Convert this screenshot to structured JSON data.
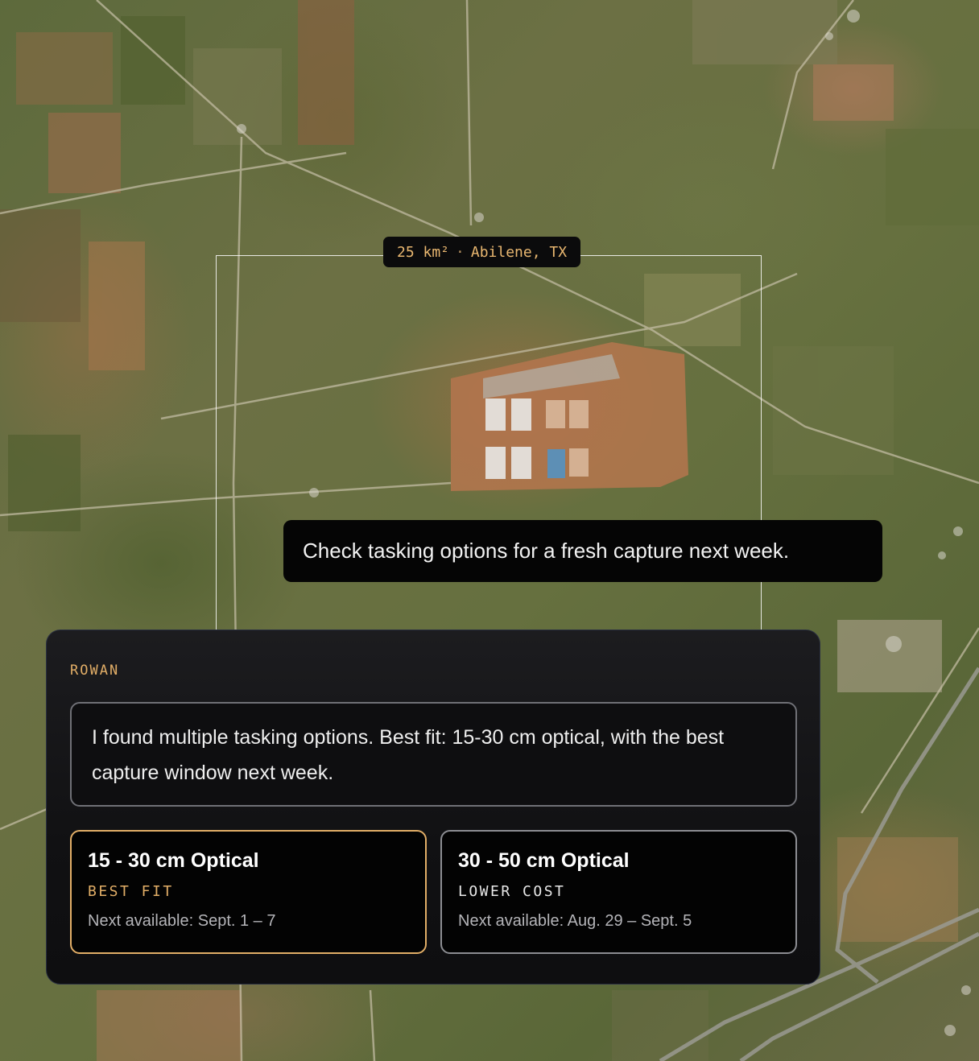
{
  "aoi": {
    "area": "25 km²",
    "separator": "·",
    "location": "Abilene, TX"
  },
  "user_message": "Check tasking options for a fresh capture next week.",
  "assistant": {
    "name": "ROWAN",
    "reply": "I found multiple tasking options. Best fit: 15-30 cm optical, with the best capture window next week."
  },
  "options": [
    {
      "title": "15 - 30 cm Optical",
      "tag": "BEST FIT",
      "availability": "Next available: Sept. 1 – 7",
      "highlighted": true
    },
    {
      "title": "30 - 50 cm Optical",
      "tag": "LOWER COST",
      "availability": "Next available: Aug. 29 – Sept. 5",
      "highlighted": false
    }
  ],
  "colors": {
    "accent": "#e2ae67",
    "panel_bg": "#111113",
    "bubble_bg": "#050505"
  }
}
